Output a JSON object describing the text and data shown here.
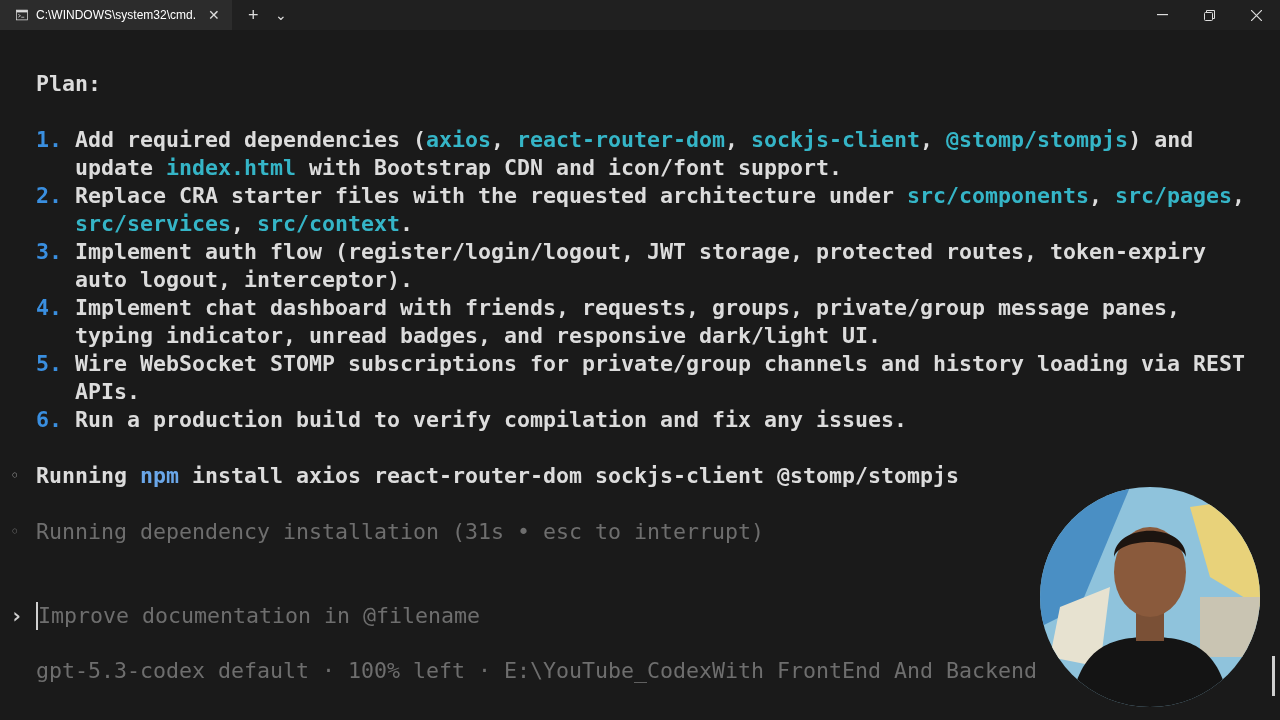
{
  "window": {
    "tab_title": "C:\\WINDOWS\\system32\\cmd.",
    "tab_close": "✕",
    "new_tab": "+",
    "tab_menu": "⌄",
    "selected": true
  },
  "heading": "Plan:",
  "plan": [
    {
      "number": "1.",
      "lines": [
        [
          {
            "text": "Add required dependencies (",
            "kind": "plain"
          },
          {
            "text": "axios",
            "kind": "code"
          },
          {
            "text": ", ",
            "kind": "plain"
          },
          {
            "text": "react-router-dom",
            "kind": "code"
          },
          {
            "text": ", ",
            "kind": "plain"
          },
          {
            "text": "sockjs-client",
            "kind": "code"
          },
          {
            "text": ", ",
            "kind": "plain"
          },
          {
            "text": "@stomp/stompjs",
            "kind": "code"
          },
          {
            "text": ") and",
            "kind": "plain"
          }
        ],
        [
          {
            "text": "update ",
            "kind": "plain"
          },
          {
            "text": "index.html",
            "kind": "code"
          },
          {
            "text": " with Bootstrap CDN and icon/font support.",
            "kind": "plain"
          }
        ]
      ]
    },
    {
      "number": "2.",
      "lines": [
        [
          {
            "text": "Replace CRA starter files with the requested architecture under ",
            "kind": "plain"
          },
          {
            "text": "src/components",
            "kind": "code"
          },
          {
            "text": ", ",
            "kind": "plain"
          },
          {
            "text": "src/pages",
            "kind": "code"
          },
          {
            "text": ",",
            "kind": "plain"
          }
        ],
        [
          {
            "text": "src/services",
            "kind": "code"
          },
          {
            "text": ", ",
            "kind": "plain"
          },
          {
            "text": "src/context",
            "kind": "code"
          },
          {
            "text": ".",
            "kind": "plain"
          }
        ]
      ]
    },
    {
      "number": "3.",
      "lines": [
        [
          {
            "text": "Implement auth flow (register/login/logout, JWT storage, protected routes, token-expiry",
            "kind": "plain"
          }
        ],
        [
          {
            "text": "auto logout, interceptor).",
            "kind": "plain"
          }
        ]
      ]
    },
    {
      "number": "4.",
      "lines": [
        [
          {
            "text": "Implement chat dashboard with friends, requests, groups, private/group message panes,",
            "kind": "plain"
          }
        ],
        [
          {
            "text": "typing indicator, unread badges, and responsive dark/light UI.",
            "kind": "plain"
          }
        ]
      ]
    },
    {
      "number": "5.",
      "lines": [
        [
          {
            "text": "Wire WebSocket STOMP subscriptions for private/group channels and history loading via REST",
            "kind": "plain"
          }
        ],
        [
          {
            "text": "APIs.",
            "kind": "plain"
          }
        ]
      ]
    },
    {
      "number": "6.",
      "lines": [
        [
          {
            "text": "Run a production build to verify compilation and fix any issues.",
            "kind": "plain"
          }
        ]
      ]
    }
  ],
  "events": [
    {
      "bullet": "◦",
      "dim": false,
      "segments": [
        {
          "text": "Running ",
          "kind": "plain"
        },
        {
          "text": "npm",
          "kind": "cmd"
        },
        {
          "text": " install axios react-router-dom sockjs-client @stomp/stompjs",
          "kind": "plain"
        }
      ]
    },
    {
      "bullet": "◦",
      "dim": true,
      "segments": [
        {
          "text": "Running dependency installation (31s • esc to interrupt)",
          "kind": "plain"
        }
      ]
    }
  ],
  "prompt": {
    "marker": "›",
    "placeholder": "Improve documentation in @filename"
  },
  "status_line": "gpt-5.3-codex default · 100% left · E:\\YouTube_CodexWith FrontEnd And Backend"
}
